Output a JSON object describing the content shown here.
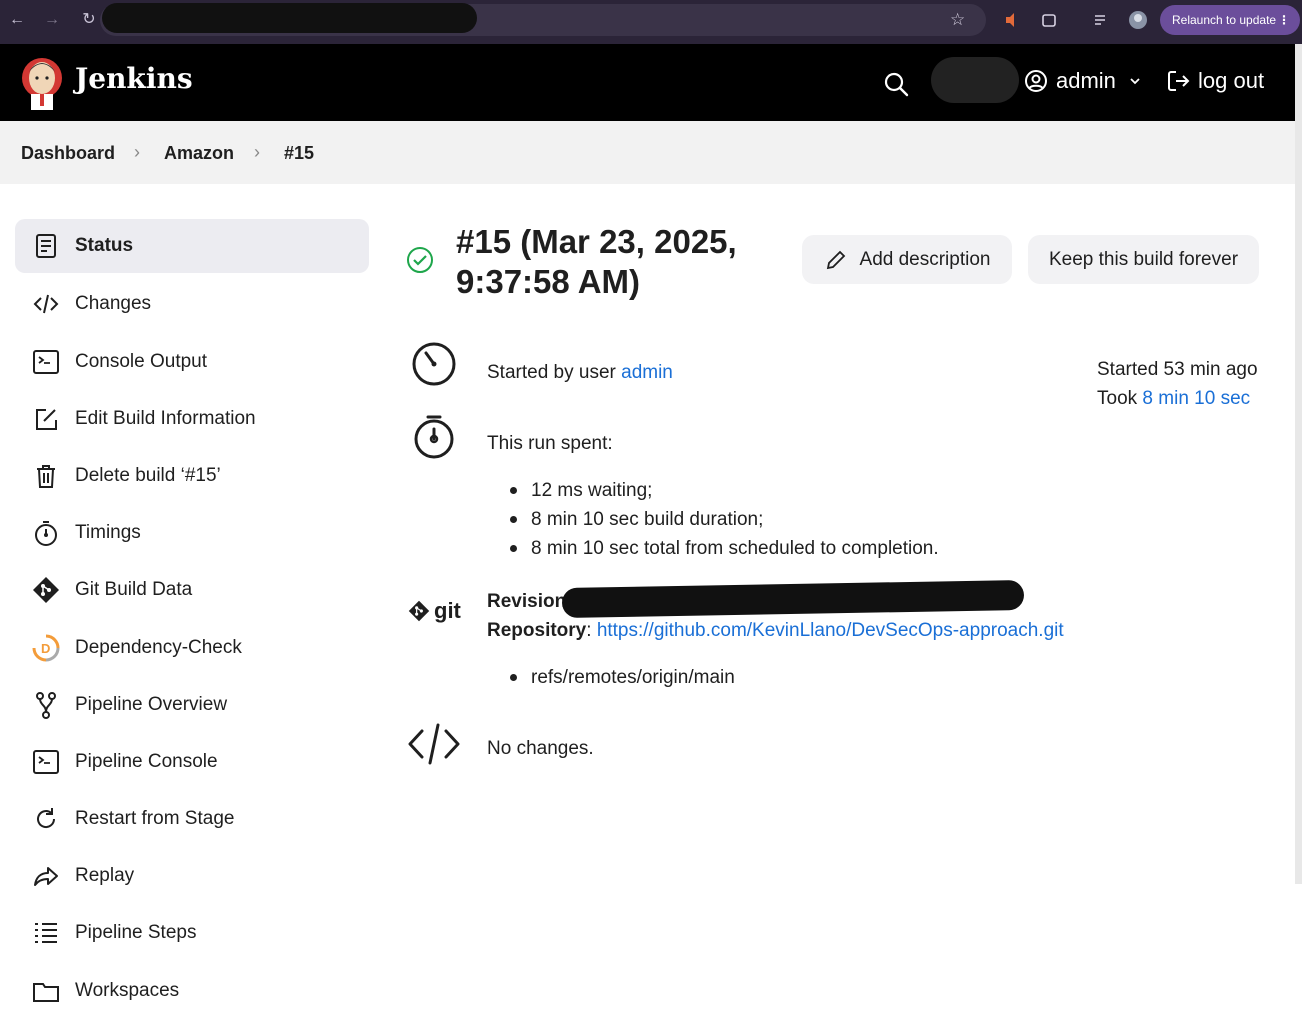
{
  "browser": {
    "relaunch_label": "Relaunch to update"
  },
  "header": {
    "brand": "Jenkins",
    "user": "admin",
    "logout": "log out"
  },
  "breadcrumb": [
    "Dashboard",
    "Amazon",
    "#15"
  ],
  "sidebar": {
    "items": [
      {
        "label": "Status",
        "icon": "status-icon"
      },
      {
        "label": "Changes",
        "icon": "code-icon"
      },
      {
        "label": "Console Output",
        "icon": "terminal-icon"
      },
      {
        "label": "Edit Build Information",
        "icon": "edit-icon"
      },
      {
        "label": "Delete build ‘#15’",
        "icon": "trash-icon"
      },
      {
        "label": "Timings",
        "icon": "stopwatch-icon"
      },
      {
        "label": "Git Build Data",
        "icon": "git-icon"
      },
      {
        "label": "Dependency-Check",
        "icon": "dependency-check-icon"
      },
      {
        "label": "Pipeline Overview",
        "icon": "branch-icon"
      },
      {
        "label": "Pipeline Console",
        "icon": "terminal-icon"
      },
      {
        "label": "Restart from Stage",
        "icon": "restart-icon"
      },
      {
        "label": "Replay",
        "icon": "replay-icon"
      },
      {
        "label": "Pipeline Steps",
        "icon": "list-icon"
      },
      {
        "label": "Workspaces",
        "icon": "folder-icon"
      }
    ]
  },
  "build": {
    "title_line1": "#15 (Mar 23, 2025,",
    "title_line2": "9:37:58 AM)",
    "add_description": "Add description",
    "keep_forever": "Keep this build forever",
    "started_by_prefix": "Started by user ",
    "started_by_user": "admin",
    "started_ago": "Started 53 min ago",
    "took_prefix": "Took ",
    "took_value": "8 min 10 sec",
    "run_spent": "This run spent:",
    "spent_items": [
      "12 ms waiting;",
      "8 min 10 sec build duration;",
      "8 min 10 sec total from scheduled to completion."
    ],
    "git_logo_text": "git",
    "revision_label": "Revision",
    "repository_label": "Repository",
    "repository_url": "https://github.com/KevinLlano/DevSecOps-approach.git",
    "refs": [
      "refs/remotes/origin/main"
    ],
    "no_changes": "No changes."
  },
  "colors": {
    "link": "#1a6fd6",
    "success": "#1ea64b",
    "header_bg": "#000000"
  }
}
